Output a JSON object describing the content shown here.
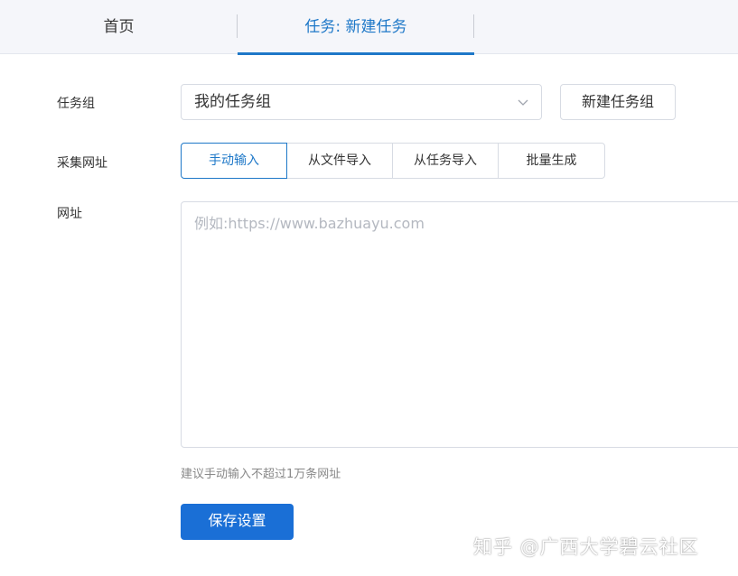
{
  "tabs": {
    "home_label": "首页",
    "active_label": "任务: 新建任务"
  },
  "form": {
    "task_group_label": "任务组",
    "task_group_value": "我的任务组",
    "new_group_button": "新建任务组",
    "collect_url_label": "采集网址",
    "input_modes": [
      "手动输入",
      "从文件导入",
      "从任务导入",
      "批量生成"
    ],
    "url_label": "网址",
    "url_placeholder": "例如:https://www.bazhuayu.com",
    "hint": "建议手动输入不超过1万条网址",
    "save_button": "保存设置"
  },
  "watermark": "知乎 @广西大学碧云社区",
  "colors": {
    "accent": "#1e78c8",
    "primary_button": "#1a6fd6",
    "border": "#d7dbe3",
    "tabbar_bg": "#f5f6fa"
  },
  "icons": {
    "select_arrow": "chevron-down-icon"
  }
}
